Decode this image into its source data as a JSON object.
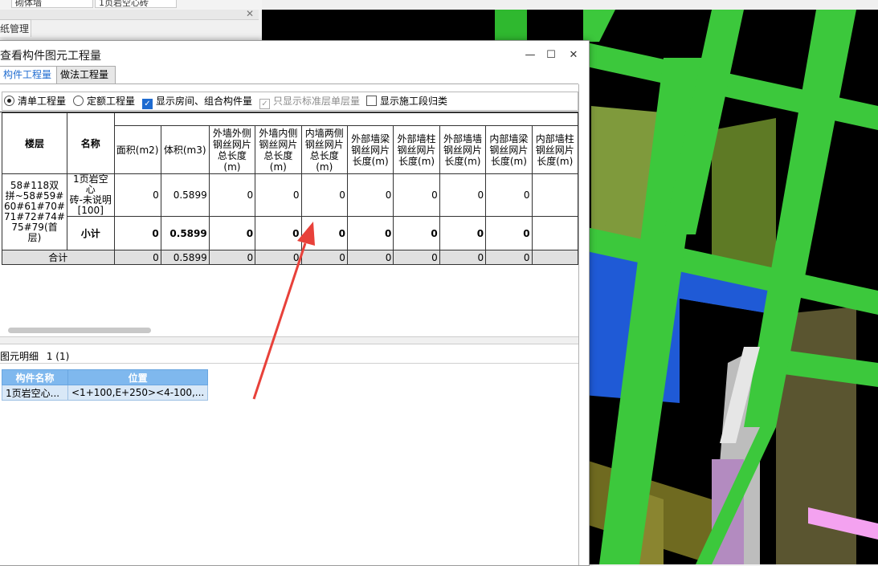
{
  "background": {
    "top_fields": [
      "砌体墙",
      "1页岩空心砖"
    ],
    "panel_tab": "纸管理"
  },
  "dialog": {
    "title": "查看构件图元工程量",
    "tabs": [
      "构件工程量",
      "做法工程量"
    ],
    "options": {
      "radio_list": "清单工程量",
      "radio_quota": "定额工程量",
      "check_show_room": "显示房间、组合构件量",
      "check_standard_floor": "只显示标准层单层量",
      "check_construction": "显示施工段归类"
    }
  },
  "quantity_table": {
    "headers": {
      "floor": "楼层",
      "name": "名称",
      "area": "面积(m2)",
      "volume": "体积(m3)",
      "col3": "外墙外侧钢丝网片总长度(m)",
      "col4": "外墙内侧钢丝网片总长度(m)",
      "col5": "内墙两侧钢丝网片总长度(m)",
      "col6": "外部墙梁钢丝网片长度(m)",
      "col7": "外部墙柱钢丝网片长度(m)",
      "col8": "外部墙墙钢丝网片长度(m)",
      "col9": "内部墙梁钢丝网片长度(m)",
      "col10": "内部墙柱钢丝网片长度(m)"
    },
    "floor": "58#118双拼~58#59#60#61#70#71#72#74#75#79(首层)",
    "floor_line1": "58#118双",
    "floor_line2": "拼~58#59#",
    "floor_line3": "60#61#70#",
    "floor_line4": "71#72#74#",
    "floor_line5": "75#79(首",
    "floor_line6": "层)",
    "row_item": {
      "name_line1": "1页岩空心",
      "name_line2": "砖-未说明",
      "name_line3": "[100]",
      "area": "0",
      "volume": "0.5899",
      "c3": "0",
      "c4": "0",
      "c5": "0",
      "c6": "0",
      "c7": "0",
      "c8": "0",
      "c9": "0"
    },
    "row_subtotal": {
      "name": "小计",
      "area": "0",
      "volume": "0.5899",
      "c3": "0",
      "c4": "0",
      "c5": "0",
      "c6": "0",
      "c7": "0",
      "c8": "0",
      "c9": "0"
    },
    "row_total": {
      "name": "合计",
      "area": "0",
      "volume": "0.5899",
      "c3": "0",
      "c4": "0",
      "c5": "0",
      "c6": "0",
      "c7": "0",
      "c8": "0",
      "c9": "0"
    }
  },
  "detail": {
    "title": "图元明细",
    "count": "1 (1)",
    "headers": [
      "构件名称",
      "位置"
    ],
    "rows": [
      {
        "name": "1页岩空心...",
        "position": "<1+100,E+250><4-100,..."
      }
    ]
  },
  "colors": {
    "arrow": "#e8413a",
    "beam_green": "#3cc83c",
    "wall_olive": "#7f9a3c",
    "slab_blue": "#1f5ad6",
    "accent_blue": "#1e6bd0"
  }
}
